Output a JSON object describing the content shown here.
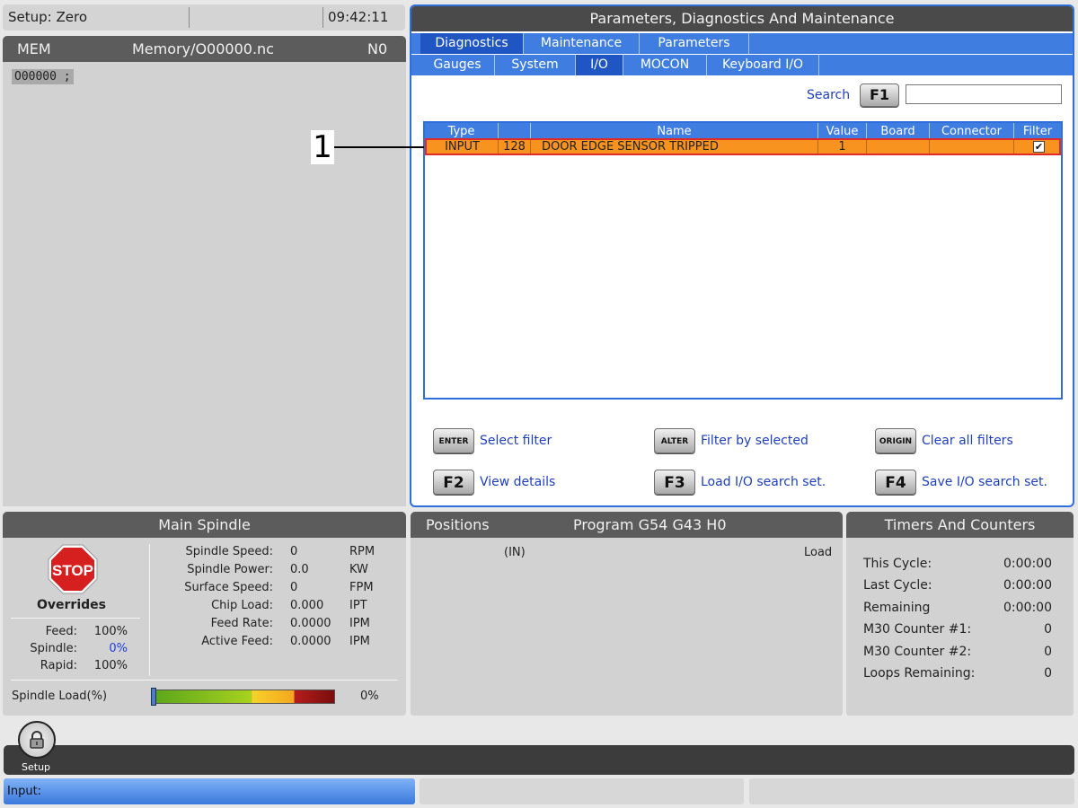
{
  "status_bar": {
    "mode": "Setup: Zero",
    "time": "09:42:11"
  },
  "program_pane": {
    "mode": "MEM",
    "filename": "Memory/O00000.nc",
    "line_number": "N0",
    "code_line": "O00000 ;"
  },
  "pdm": {
    "title": "Parameters, Diagnostics And Maintenance",
    "tabs": [
      "Diagnostics",
      "Maintenance",
      "Parameters"
    ],
    "active_tab": "Diagnostics",
    "subtabs": [
      "Gauges",
      "System",
      "I/O",
      "MOCON",
      "Keyboard I/O"
    ],
    "active_subtab": "I/O",
    "search_label": "Search",
    "search_key": "F1",
    "search_value": "",
    "table": {
      "columns": [
        "Type",
        "",
        "Name",
        "Value",
        "Board",
        "Connector",
        "Filter"
      ],
      "rows": [
        {
          "type": "INPUT",
          "number": "128",
          "name": "DOOR EDGE SENSOR TRIPPED",
          "value": "1",
          "board": "",
          "connector": "",
          "filter": true
        }
      ]
    },
    "hotkeys": [
      {
        "key": "ENTER",
        "label": "Select filter"
      },
      {
        "key": "ALTER",
        "label": "Filter by selected"
      },
      {
        "key": "ORIGIN",
        "label": "Clear all filters"
      },
      {
        "key": "F2",
        "label": "View details"
      },
      {
        "key": "F3",
        "label": "Load I/O search set."
      },
      {
        "key": "F4",
        "label": "Save I/O search set."
      }
    ]
  },
  "callout": {
    "number": "1"
  },
  "main_spindle": {
    "title": "Main Spindle",
    "stop_label": "STOP",
    "overrides_label": "Overrides",
    "overrides": [
      {
        "label": "Feed:",
        "value": "100%"
      },
      {
        "label": "Spindle:",
        "value": "0%"
      },
      {
        "label": "Rapid:",
        "value": "100%"
      }
    ],
    "readings": [
      {
        "label": "Spindle Speed:",
        "value": "0",
        "unit": "RPM"
      },
      {
        "label": "Spindle Power:",
        "value": "0.0",
        "unit": "KW"
      },
      {
        "label": "Surface Speed:",
        "value": "0",
        "unit": "FPM"
      },
      {
        "label": "Chip Load:",
        "value": "0.000",
        "unit": "IPT"
      },
      {
        "label": "Feed Rate:",
        "value": "0.0000",
        "unit": "IPM"
      },
      {
        "label": "Active Feed:",
        "value": "0.0000",
        "unit": "IPM"
      }
    ],
    "load_label": "Spindle Load(%)",
    "load_value": "0%",
    "load_fraction": 0.0
  },
  "positions": {
    "title": "Positions",
    "program": "Program G54 G43 H0",
    "units": "(IN)",
    "load_label": "Load"
  },
  "timers": {
    "title": "Timers And Counters",
    "items": [
      {
        "label": "This Cycle:",
        "value": "0:00:00"
      },
      {
        "label": "Last Cycle:",
        "value": "0:00:00"
      },
      {
        "label": "Remaining",
        "value": "0:00:00"
      },
      {
        "label": "M30 Counter #1:",
        "value": "0"
      },
      {
        "label": "M30 Counter #2:",
        "value": "0"
      },
      {
        "label": "Loops Remaining:",
        "value": "0"
      }
    ]
  },
  "bottom": {
    "setup_label": "Setup",
    "input_label": "Input:"
  },
  "colors": {
    "accent_blue": "#3f7ee0",
    "selected_row": "#f7931e",
    "selection_border": "#e02a2a",
    "header_gray": "#5c5c5c",
    "stop_red": "#d62020",
    "link_blue": "#1d3fbf"
  }
}
